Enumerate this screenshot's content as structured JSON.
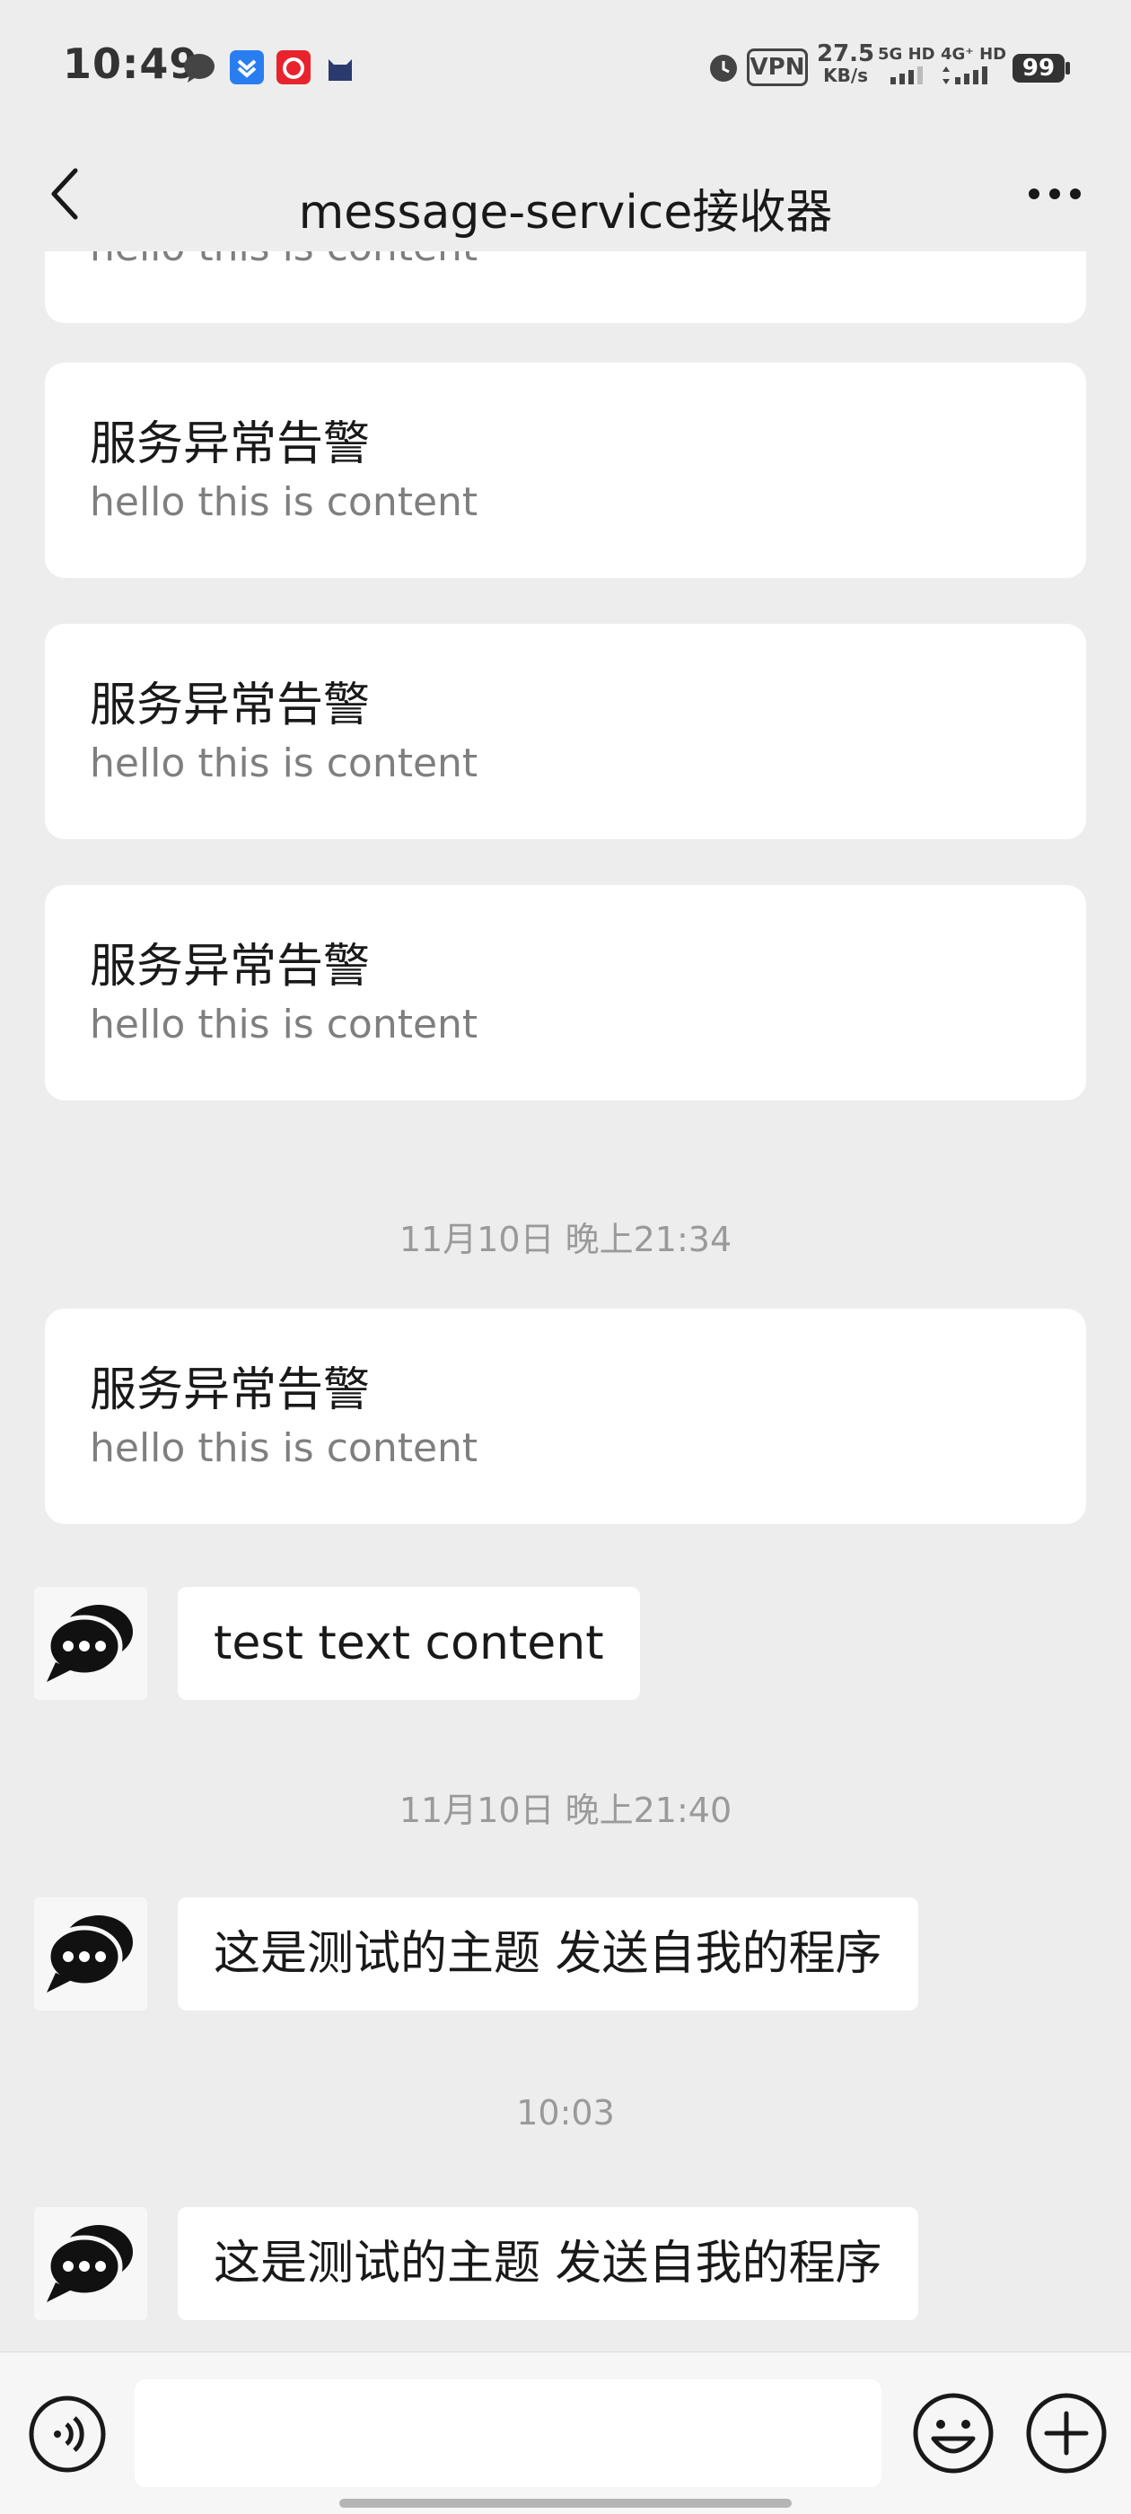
{
  "status_bar": {
    "time": "10:49",
    "net_speed": "27.5",
    "net_unit": "KB/s",
    "signal1": "5G HD",
    "signal2": "4G⁺ HD",
    "battery": "99",
    "vpn": "VPN"
  },
  "header": {
    "title": "message-service接收器"
  },
  "cards": [
    {
      "title": "",
      "body": "hello this is content"
    },
    {
      "title": "服务异常告警",
      "body": "hello this is content"
    },
    {
      "title": "服务异常告警",
      "body": "hello this is content"
    },
    {
      "title": "服务异常告警",
      "body": "hello this is content"
    },
    {
      "title": "服务异常告警",
      "body": "hello this is content"
    }
  ],
  "timestamps": [
    "11月10日 晚上21:34",
    "11月10日 晚上21:40",
    "10:03"
  ],
  "messages": [
    {
      "text": "test text content"
    },
    {
      "text": "这是测试的主题 发送自我的程序"
    },
    {
      "text": "这是测试的主题 发送自我的程序"
    }
  ],
  "input": {
    "placeholder": ""
  },
  "colors": {
    "background": "#ededed",
    "card": "#ffffff",
    "muted_text": "#7f7f7f",
    "timestamp": "#9a9a9a"
  }
}
